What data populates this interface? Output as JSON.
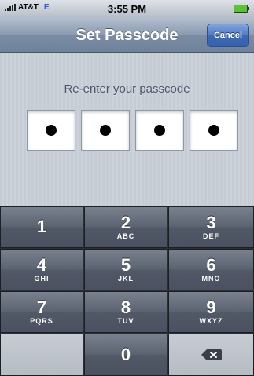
{
  "status_bar": {
    "carrier": "AT&T",
    "network": "E",
    "time": "3:55 PM"
  },
  "nav": {
    "title": "Set Passcode",
    "cancel_label": "Cancel"
  },
  "prompt": "Re-enter your passcode",
  "passcode": {
    "filled": 4,
    "length": 4
  },
  "keypad": {
    "keys": [
      {
        "num": "1",
        "letters": ""
      },
      {
        "num": "2",
        "letters": "ABC"
      },
      {
        "num": "3",
        "letters": "DEF"
      },
      {
        "num": "4",
        "letters": "GHI"
      },
      {
        "num": "5",
        "letters": "JKL"
      },
      {
        "num": "6",
        "letters": "MNO"
      },
      {
        "num": "7",
        "letters": "PQRS"
      },
      {
        "num": "8",
        "letters": "TUV"
      },
      {
        "num": "9",
        "letters": "WXYZ"
      },
      {
        "num": "0",
        "letters": ""
      }
    ],
    "delete_icon": "backspace-icon"
  }
}
